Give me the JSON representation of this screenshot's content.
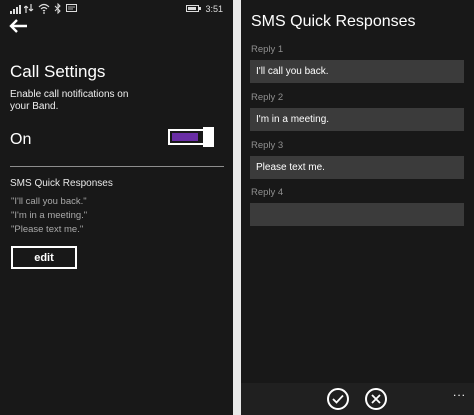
{
  "left": {
    "status": {
      "time": "3:51"
    },
    "title": "Call Settings",
    "description": "Enable call notifications on your Band.",
    "state_label": "On",
    "toggle_on": true,
    "sms_section": {
      "title": "SMS Quick Responses",
      "replies": [
        "\"I'll call you back.\"",
        "\"I'm in a meeting.\"",
        "\"Please text me.\""
      ],
      "edit_label": "edit"
    }
  },
  "right": {
    "title": "SMS Quick Responses",
    "replies": [
      {
        "label": "Reply 1",
        "value": "I'll call you back."
      },
      {
        "label": "Reply 2",
        "value": "I'm in a meeting."
      },
      {
        "label": "Reply 3",
        "value": "Please text me."
      },
      {
        "label": "Reply 4",
        "value": ""
      }
    ],
    "appbar": {
      "more": "..."
    }
  },
  "colors": {
    "accent": "#6a2ea5",
    "background": "#181818",
    "input": "#3b3b3b"
  }
}
